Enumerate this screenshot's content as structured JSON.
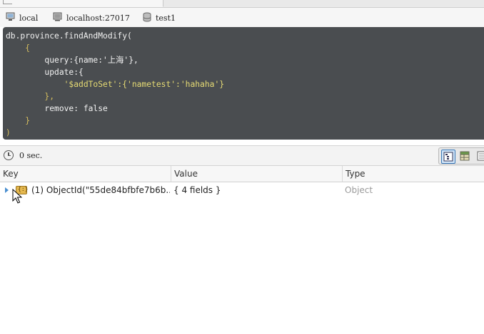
{
  "connection": {
    "server_name": "local",
    "host": "localhost:27017",
    "database": "test1"
  },
  "editor": {
    "lines": [
      "db.province.findAndModify(",
      "    {",
      "        query:{name:'上海'},",
      "        update:{",
      "            '$addToSet':{'nametest':'hahaha'}",
      "        },",
      "        remove: false",
      "    }",
      ")"
    ]
  },
  "status": {
    "elapsed": "0 sec."
  },
  "results": {
    "columns": [
      "Key",
      "Value",
      "Type"
    ],
    "rows": [
      {
        "key": "(1) ObjectId(\"55de84bfbfe7b6b...",
        "value": "{ 4 fields }",
        "type": "Object"
      }
    ]
  },
  "colors": {
    "editor_bg": "#4a4d50",
    "string": "#e6db74",
    "keyword": "#9cc4e8",
    "type_text": "#9a9a9a"
  },
  "icons": {
    "server": "computer-icon",
    "host": "monitor-icon",
    "database": "database-icon",
    "status": "clock-icon",
    "view_modes": [
      "tree-view-icon",
      "table-view-icon",
      "text-view-icon"
    ],
    "row_type": "document-icon"
  }
}
